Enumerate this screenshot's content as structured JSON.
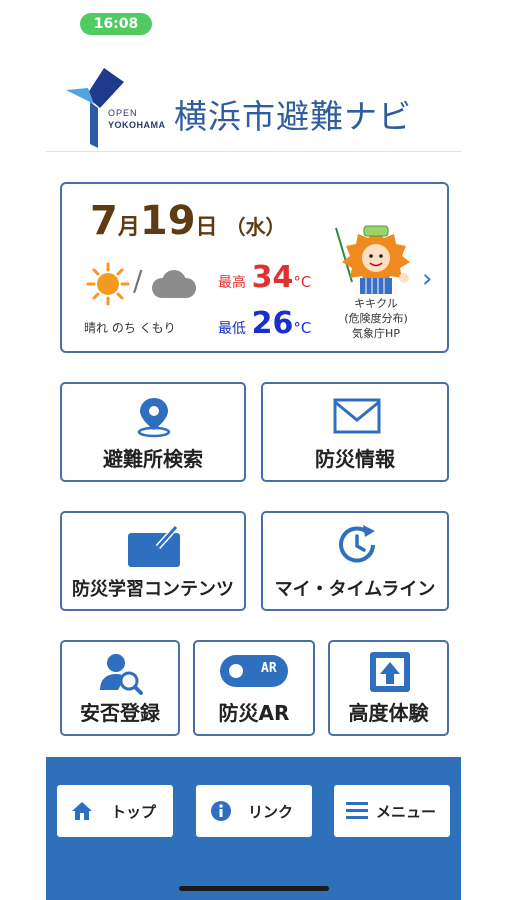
{
  "status": {
    "time": "16:08"
  },
  "header": {
    "logo_open": "OPEN",
    "logo_city": "YOKOHAMA",
    "title": "横浜市避難ナビ"
  },
  "weather": {
    "month": "7",
    "month_suffix": "月",
    "day": "19",
    "day_suffix": "日",
    "weekday": "（水）",
    "forecast": "晴れ のち くもり",
    "high_label": "最高",
    "high": "34",
    "low_label": "最低",
    "low": "26",
    "unit": "°C",
    "slash": "/",
    "icons": [
      "sun-icon",
      "cloud-icon"
    ],
    "kikikuru_line1": "キキクル",
    "kikikuru_line2": "(危険度分布)",
    "kikikuru_line3": "気象庁HP",
    "colors": {
      "date": "#5e3b12",
      "high": "#e03131",
      "low": "#1a2fc7",
      "accent": "#2f6fd6"
    }
  },
  "menu": {
    "shelter_search": "避難所検索",
    "disaster_info": "防災情報",
    "learning": "防災学習コンテンツ",
    "timeline": "マイ・タイムライン",
    "safety_register": "安否登録",
    "ar_label": "防災AR",
    "ar_badge": "AR",
    "altitude": "高度体験"
  },
  "bottom_nav": {
    "top": "トップ",
    "link": "リンク",
    "menu": "メニュー"
  },
  "theme": {
    "primary": "#2e70ba",
    "border": "#4a6fa5",
    "status_green": "#4fcb5f"
  }
}
